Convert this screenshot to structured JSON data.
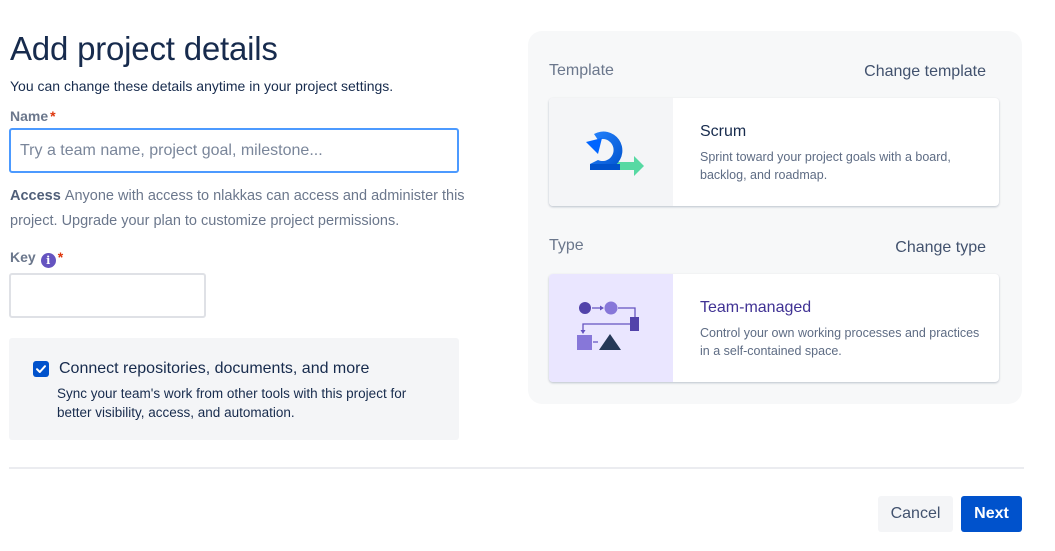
{
  "header": {
    "title": "Add project details",
    "subtitle": "You can change these details anytime in your project settings."
  },
  "form": {
    "name_label": "Name",
    "required_mark": "*",
    "name_placeholder": "Try a team name, project goal, milestone...",
    "name_value": "",
    "access_label": "Access",
    "access_text": "Anyone with access to nlakkas can access and administer this project. Upgrade your plan to customize project permissions.",
    "key_label": "Key",
    "key_info_glyph": "i",
    "key_value": ""
  },
  "connect": {
    "checked": true,
    "title": "Connect repositories, documents, and more",
    "description": "Sync your team's work from other tools with this project for better visibility, access, and automation."
  },
  "template_section": {
    "label": "Template",
    "change_label": "Change template",
    "card_title": "Scrum",
    "card_description": "Sprint toward your project goals with a board, backlog, and roadmap.",
    "icon": "scrum-icon"
  },
  "type_section": {
    "label": "Type",
    "change_label": "Change type",
    "card_title": "Team-managed",
    "card_description": "Control your own working processes and practices in a self-contained space.",
    "icon": "team-managed-icon"
  },
  "footer": {
    "cancel_label": "Cancel",
    "next_label": "Next"
  },
  "colors": {
    "primary": "#0052cc",
    "focus_border": "#4c9aff",
    "purple": "#6554c0",
    "type_title": "#403294",
    "text": "#172b4d"
  }
}
